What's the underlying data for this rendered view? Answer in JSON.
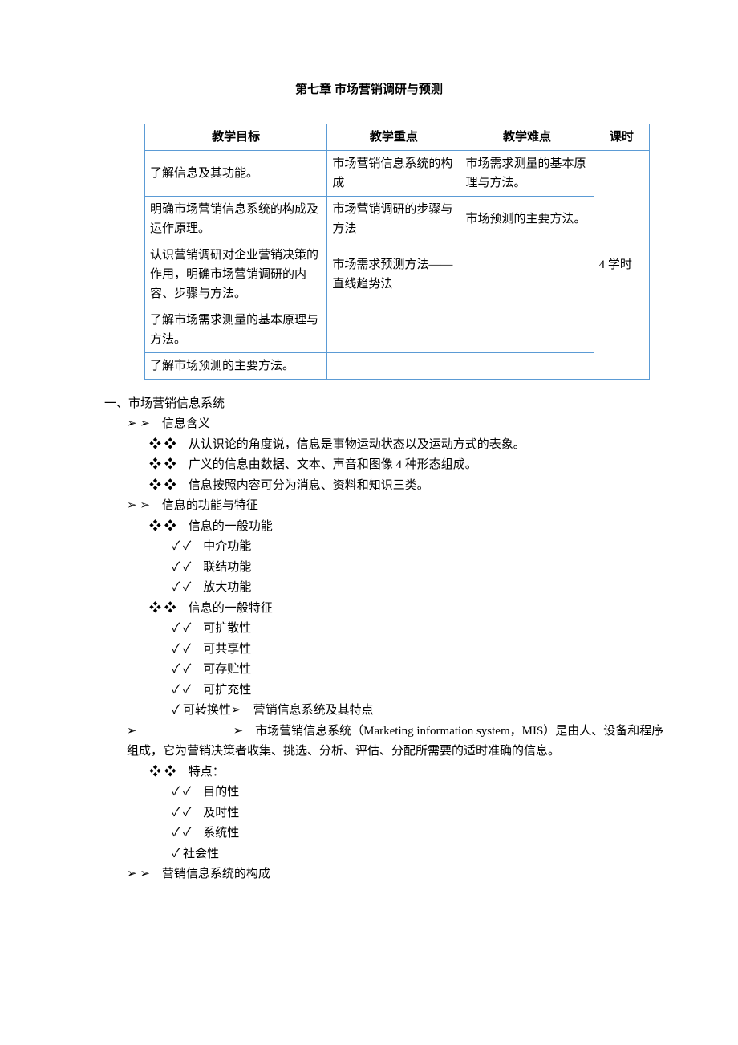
{
  "title": "第七章 市场营销调研与预测",
  "table": {
    "headers": [
      "教学目标",
      "教学重点",
      "教学难点",
      "课时"
    ],
    "rows": [
      [
        "了解信息及其功能。",
        "市场营销信息系统的构成",
        "市场需求测量的基本原理与方法。"
      ],
      [
        "明确市场营销信息系统的构成及运作原理。",
        "市场营销调研的步骤与方法",
        "市场预测的主要方法。"
      ],
      [
        "认识营销调研对企业营销决策的作用，明确市场营销调研的内容、步骤与方法。",
        "市场需求预测方法——直线趋势法",
        ""
      ],
      [
        "了解市场需求测量的基本原理与方法。",
        "",
        ""
      ],
      [
        "了解市场预测的主要方法。",
        "",
        ""
      ]
    ],
    "hours": "4 学时"
  },
  "section1": {
    "heading": "一、市场营销信息系统",
    "item1": {
      "label": "➢  ➢　信息含义",
      "sub1": "❖  ❖　从认识论的角度说，信息是事物运动状态以及运动方式的表象。",
      "sub2": "❖  ❖　广义的信息由数据、文本、声音和图像 4 种形态组成。",
      "sub3": "❖  ❖　信息按照内容可分为消息、资料和知识三类。"
    },
    "item2": {
      "label": "➢  ➢　信息的功能与特征",
      "sub1": {
        "label": "❖  ❖　信息的一般功能",
        "a": "✓  ✓　中介功能",
        "b": "✓  ✓　联结功能",
        "c": "✓  ✓　放大功能"
      },
      "sub2": {
        "label": "❖  ❖　信息的一般特征",
        "a": "✓  ✓　可扩散性",
        "b": "✓  ✓　可共享性",
        "c": "✓  ✓　可存贮性",
        "d": "✓  ✓　可扩充性",
        "e": "✓  可转换性➢　营销信息系统及其特点"
      }
    },
    "item3": {
      "lead": "➢　　　　　　　　➢　市场营销信息系统（Marketing information system，MIS）是由人、设备和程序组成，它为营销决策者收集、挑选、分析、评估、分配所需要的适时准确的信息。",
      "sub1": {
        "label": "❖  ❖　特点：",
        "a": "✓  ✓　目的性",
        "b": "✓  ✓　及时性",
        "c": "✓  ✓　系统性",
        "d": "✓  社会性"
      }
    },
    "item4": "➢  ➢　营销信息系统的构成"
  }
}
